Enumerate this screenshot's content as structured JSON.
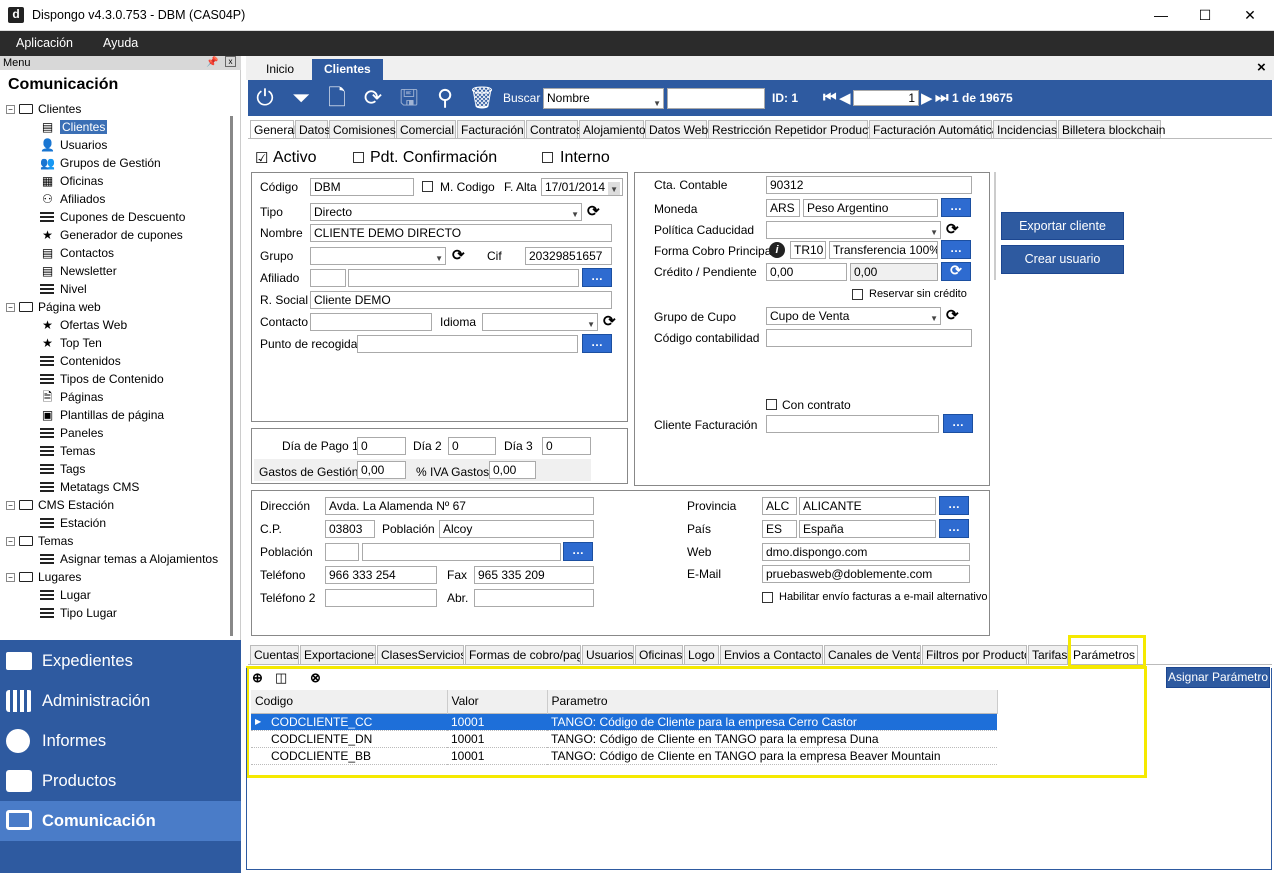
{
  "window": {
    "title": "Dispongo v4.3.0.753 - DBM (CAS04P)",
    "logo": "d",
    "minimize": "—",
    "maximize": "☐",
    "close": "✕"
  },
  "menubar": [
    "Aplicación",
    "Ayuda"
  ],
  "left": {
    "header": "Menu",
    "section_title": "Comunicación",
    "tree": [
      {
        "label": "Clientes",
        "level": 0,
        "icon": "folder-icon"
      },
      {
        "label": "Clientes",
        "level": 1,
        "icon": "contact-card-icon",
        "selected": true
      },
      {
        "label": "Usuarios",
        "level": 1,
        "icon": "user-icon"
      },
      {
        "label": "Grupos de Gestión",
        "level": 1,
        "icon": "users-group-icon"
      },
      {
        "label": "Oficinas",
        "level": 1,
        "icon": "building-icon"
      },
      {
        "label": "Afiliados",
        "level": 1,
        "icon": "affiliates-icon"
      },
      {
        "label": "Cupones de Descuento",
        "level": 1,
        "icon": "list-icon"
      },
      {
        "label": "Generador de cupones",
        "level": 1,
        "icon": "star-icon"
      },
      {
        "label": "Contactos",
        "level": 1,
        "icon": "contact-card-icon"
      },
      {
        "label": "Newsletter",
        "level": 1,
        "icon": "contact-card-icon"
      },
      {
        "label": "Nivel",
        "level": 1,
        "icon": "list-icon"
      },
      {
        "label": "Página web",
        "level": 0,
        "icon": "folder-icon"
      },
      {
        "label": "Ofertas Web",
        "level": 1,
        "icon": "star-icon"
      },
      {
        "label": "Top Ten",
        "level": 1,
        "icon": "star-icon"
      },
      {
        "label": "Contenidos",
        "level": 1,
        "icon": "list-icon"
      },
      {
        "label": "Tipos de Contenido",
        "level": 1,
        "icon": "list-icon"
      },
      {
        "label": "Páginas",
        "level": 1,
        "icon": "page-icon"
      },
      {
        "label": "Plantillas de página",
        "level": 1,
        "icon": "template-icon"
      },
      {
        "label": "Paneles",
        "level": 1,
        "icon": "list-icon"
      },
      {
        "label": "Temas",
        "level": 1,
        "icon": "list-icon"
      },
      {
        "label": "Tags",
        "level": 1,
        "icon": "list-icon"
      },
      {
        "label": "Metatags CMS",
        "level": 1,
        "icon": "list-icon"
      },
      {
        "label": "CMS Estación",
        "level": 0,
        "icon": "folder-icon"
      },
      {
        "label": "Estación",
        "level": 1,
        "icon": "list-icon"
      },
      {
        "label": "Temas",
        "level": 0,
        "icon": "folder-icon"
      },
      {
        "label": "Asignar temas a Alojamientos",
        "level": 1,
        "icon": "list-icon"
      },
      {
        "label": "Lugares",
        "level": 0,
        "icon": "folder-icon"
      },
      {
        "label": "Lugar",
        "level": 1,
        "icon": "list-icon"
      },
      {
        "label": "Tipo Lugar",
        "level": 1,
        "icon": "list-icon"
      }
    ],
    "nav": [
      {
        "label": "Expedientes",
        "icon": "folder-icon"
      },
      {
        "label": "Administración",
        "icon": "bar-chart-icon"
      },
      {
        "label": "Informes",
        "icon": "pie-chart-icon"
      },
      {
        "label": "Productos",
        "icon": "briefcase-icon"
      },
      {
        "label": "Comunicación",
        "icon": "monitor-icon",
        "active": true
      }
    ]
  },
  "tabs": {
    "inicio": "Inicio",
    "clientes": "Clientes",
    "close": "×"
  },
  "toolbar": {
    "buscar_label": "Buscar",
    "buscar_field": "Nombre",
    "search_value": "",
    "id_label": "ID: 1",
    "record": "1",
    "record_total": "1 de 19675"
  },
  "subtabs": [
    "General",
    "Datos",
    "Comisiones",
    "Comercial",
    "Facturación",
    "Contratos",
    "Alojamiento",
    "Datos Web",
    "Restricción Repetidor Producto",
    "Facturación Automática",
    "Incidencias",
    "Billetera blockchain"
  ],
  "status": {
    "activo": "Activo",
    "pdt": "Pdt. Confirmación",
    "interno": "Interno"
  },
  "form": {
    "codigo_label": "Código",
    "codigo": "DBM",
    "mcodigo_label": "M. Codigo",
    "falta_label": "F. Alta",
    "falta": "17/01/2014",
    "tipo_label": "Tipo",
    "tipo": "Directo",
    "nombre_label": "Nombre",
    "nombre": "CLIENTE DEMO DIRECTO",
    "grupo_label": "Grupo",
    "grupo": "",
    "cif_label": "Cif",
    "cif": "20329851657",
    "afiliado_label": "Afiliado",
    "afiliado_code": "",
    "afiliado_name": "",
    "rsocial_label": "R. Social",
    "rsocial": "Cliente DEMO",
    "contacto_label": "Contacto",
    "contacto": "",
    "idioma_label": "Idioma",
    "idioma": "",
    "punto_label": "Punto de recogida",
    "punto": "",
    "diapago1_label": "Día de Pago 1",
    "diapago1": "0",
    "dia2_label": "Día 2",
    "dia2": "0",
    "dia3_label": "Día 3",
    "dia3": "0",
    "gastos_label": "Gastos de Gestión",
    "gastos": "0,00",
    "iva_label": "% IVA Gastos",
    "iva": "0,00",
    "cta_label": "Cta. Contable",
    "cta": "90312",
    "moneda_label": "Moneda",
    "moneda_code": "ARS",
    "moneda_name": "Peso Argentino",
    "politica_label": "Política Caducidad",
    "politica": "",
    "forma_label": "Forma Cobro Principal",
    "forma_code": "TR10",
    "forma_name": "Transferencia 100%",
    "credito_label": "Crédito / Pendiente",
    "credito": "0,00",
    "pendiente": "0,00",
    "reservar_label": "Reservar sin crédito",
    "grupocupo_label": "Grupo de Cupo",
    "grupocupo": "Cupo de Venta",
    "codcont_label": "Código contabilidad",
    "codcont": "",
    "concontrato_label": "Con contrato",
    "clientefact_label": "Cliente Facturación",
    "clientefact": "",
    "exportar_btn": "Exportar cliente",
    "crear_btn": "Crear usuario",
    "direccion_label": "Dirección",
    "direccion": "Avda. La Alamenda Nº 67",
    "cp_label": "C.P.",
    "cp": "03803",
    "poblacion_label": "Población",
    "poblacion": "Alcoy",
    "poblacion2_label": "Población",
    "poblacion2_code": "",
    "poblacion2_name": "",
    "telefono_label": "Teléfono",
    "telefono": "966 333 254",
    "fax_label": "Fax",
    "fax": "965 335 209",
    "telefono2_label": "Teléfono 2",
    "telefono2": "",
    "abr_label": "Abr.",
    "abr": "",
    "provincia_label": "Provincia",
    "provincia_code": "ALC",
    "provincia_name": "ALICANTE",
    "pais_label": "País",
    "pais_code": "ES",
    "pais_name": "España",
    "web_label": "Web",
    "web": "dmo.dispongo.com",
    "email_label": "E-Mail",
    "email": "pruebasweb@doblemente.com",
    "habilitar_label": "Habilitar envío facturas a e-mail alternativo"
  },
  "bottomtabs": [
    "Cuentas",
    "Exportaciones",
    "ClasesServicios",
    "Formas de cobro/pago",
    "Usuarios",
    "Oficinas",
    "Logo",
    "Envios a Contactos",
    "Canales de Venta",
    "Filtros por Producto",
    "Tarifas",
    "Parámetros"
  ],
  "params": {
    "assign_btn": "Asignar Parámetro",
    "columns": [
      "Codigo",
      "Valor",
      "Parametro"
    ],
    "rows": [
      [
        "CODCLIENTE_CC",
        "10001",
        "TANGO: Código de Cliente para la empresa Cerro Castor"
      ],
      [
        "CODCLIENTE_DN",
        "10001",
        "TANGO: Código de Cliente en TANGO para la empresa Duna"
      ],
      [
        "CODCLIENTE_BB",
        "10001",
        "TANGO: Código de Cliente en TANGO para la empresa Beaver Mountain"
      ]
    ]
  }
}
